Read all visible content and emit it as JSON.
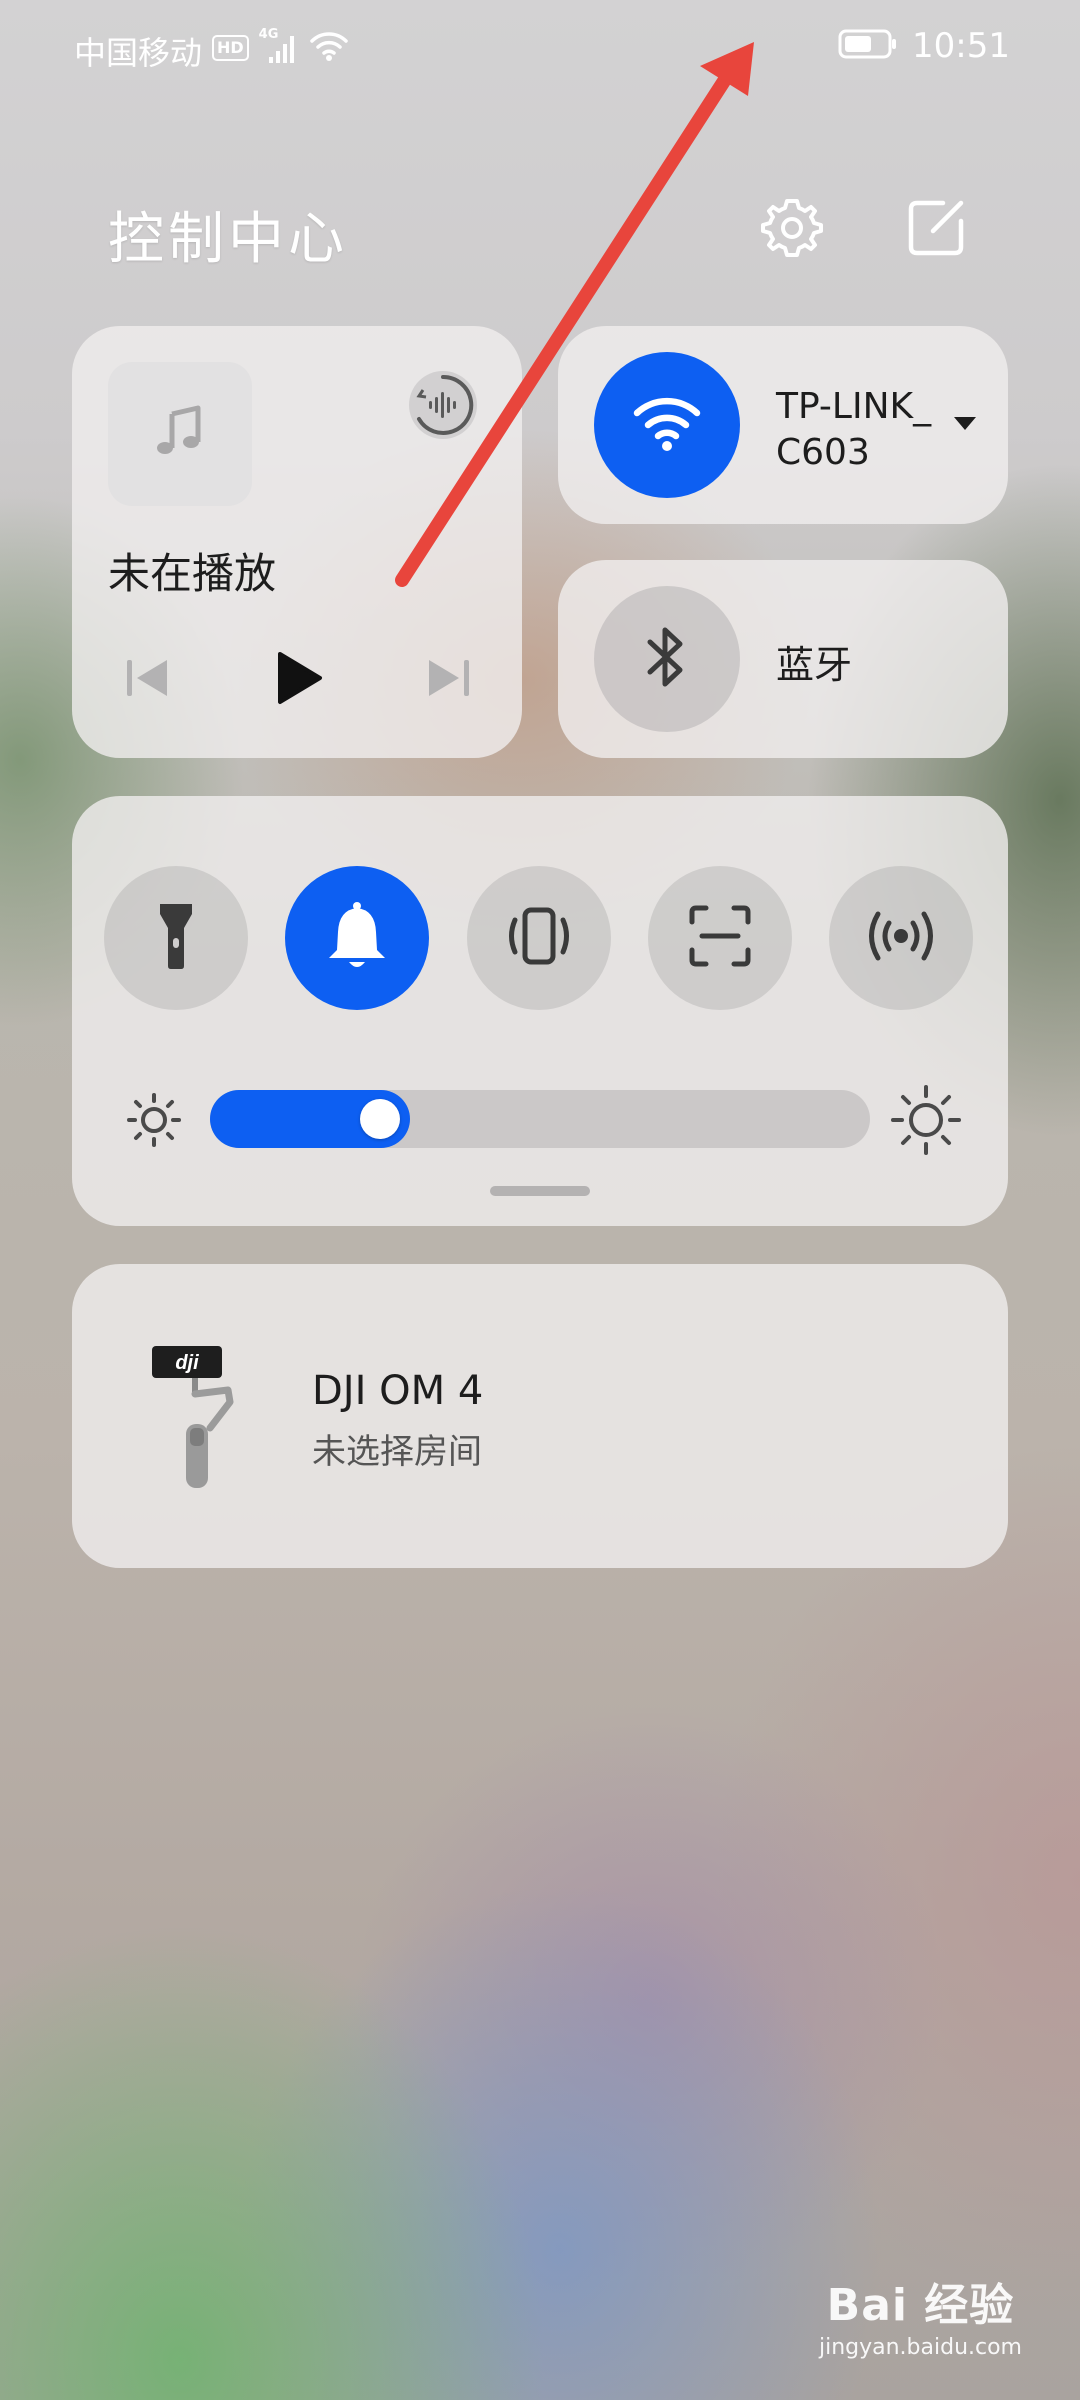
{
  "status_bar": {
    "carrier": "中国移动",
    "hd": "HD",
    "network": "4G",
    "time": "10:51",
    "battery_level": 0.65
  },
  "header": {
    "title": "控制中心",
    "icons": [
      "gear-icon",
      "edit-icon"
    ]
  },
  "media": {
    "title": "未在播放",
    "icons": [
      "music-note-icon",
      "audio-output-icon",
      "previous-icon",
      "play-icon",
      "next-icon"
    ]
  },
  "wifi": {
    "name": "TP-LINK_C603",
    "enabled": true
  },
  "bluetooth": {
    "label": "蓝牙",
    "enabled": false
  },
  "toggles": [
    {
      "icon": "flashlight-icon",
      "active": false
    },
    {
      "icon": "bell-icon",
      "active": true
    },
    {
      "icon": "vibrate-icon",
      "active": false
    },
    {
      "icon": "screenshot-icon",
      "active": false
    },
    {
      "icon": "hotspot-icon",
      "active": false
    }
  ],
  "brightness": {
    "level": 0.24
  },
  "device": {
    "name": "DJI OM 4",
    "room": "未选择房间",
    "brand": "dji"
  },
  "watermark": {
    "logo": "Bai 经验",
    "url": "jingyan.baidu.com"
  },
  "colors": {
    "accent": "#0d5ff2",
    "annotation_arrow": "#e8453c"
  }
}
